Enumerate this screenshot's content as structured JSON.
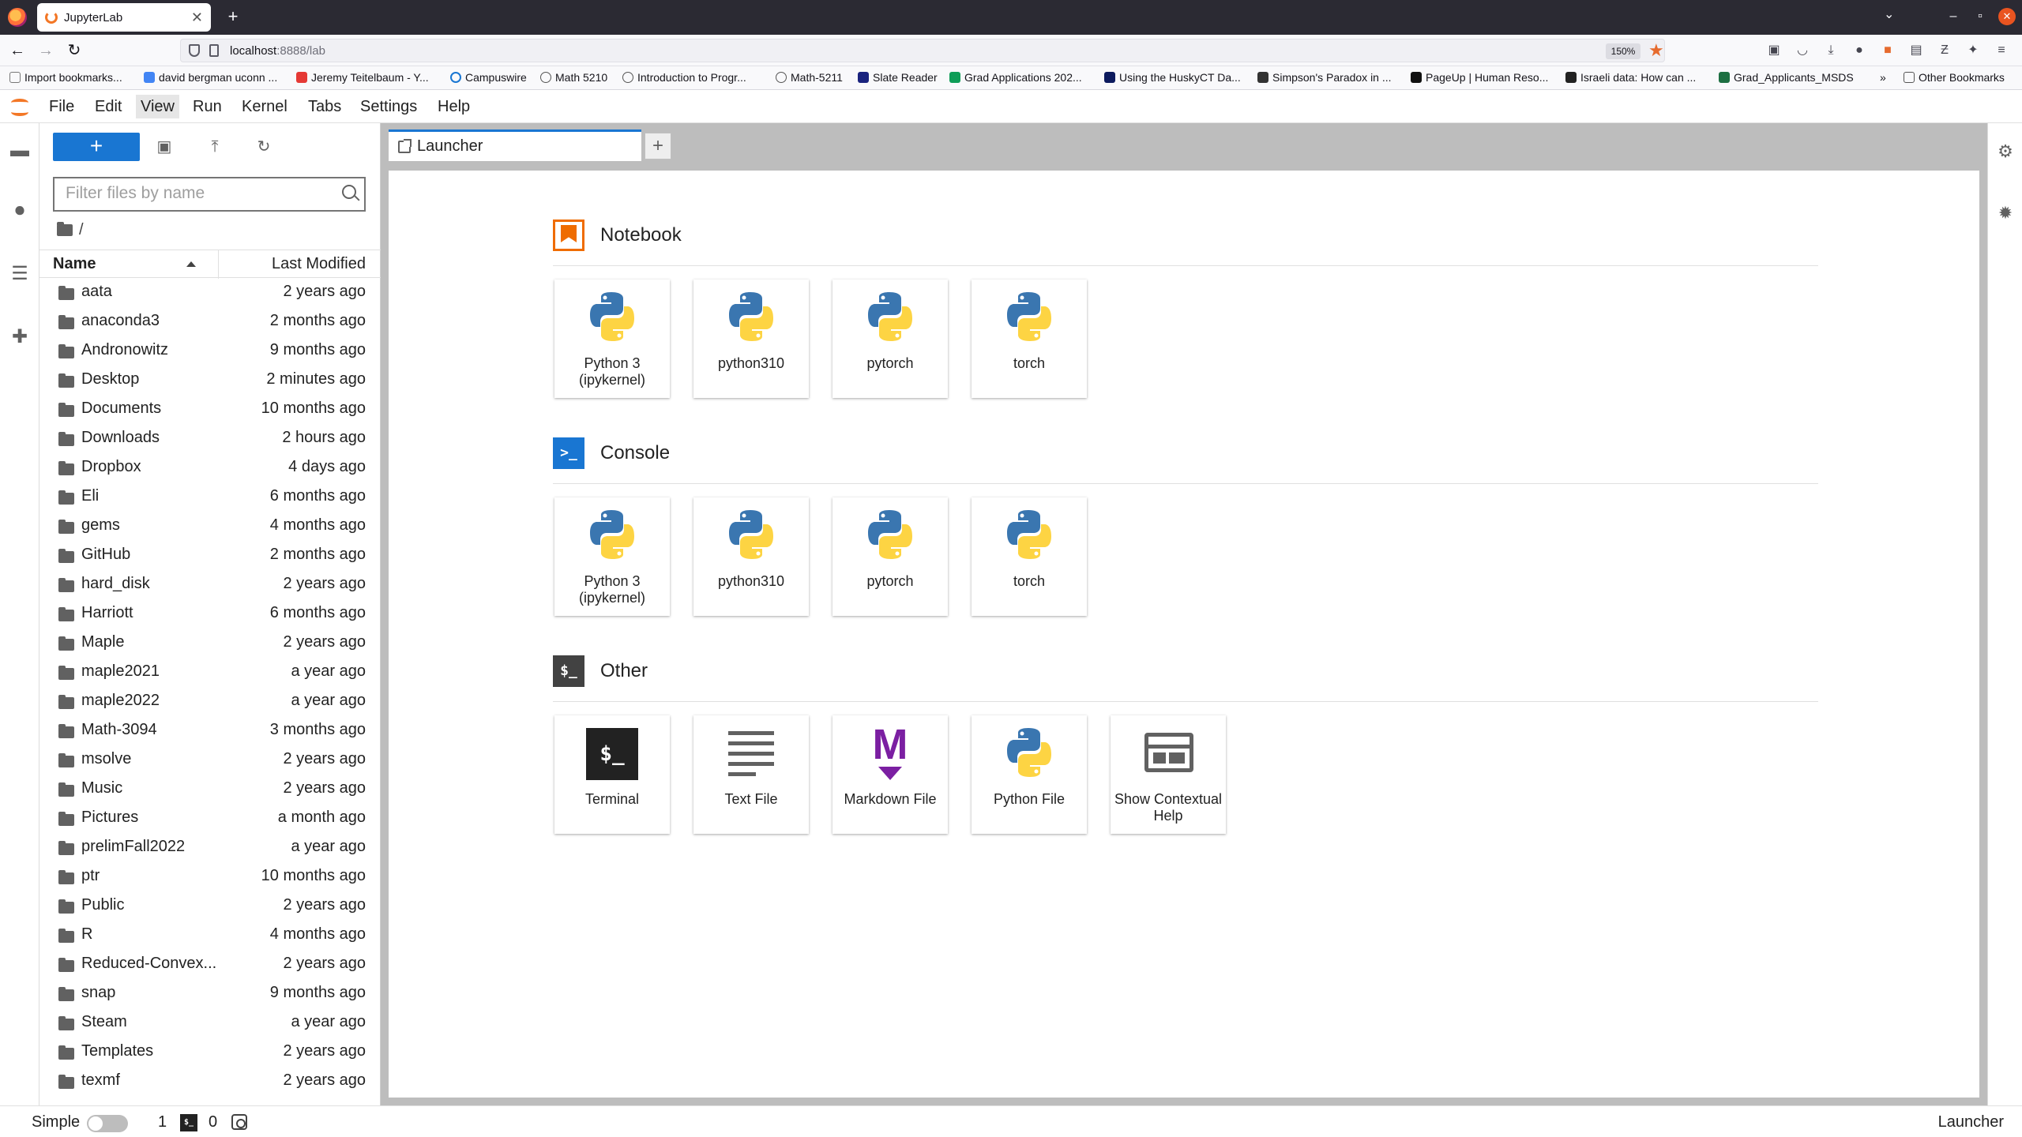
{
  "browser": {
    "tab_title": "JupyterLab",
    "url_host": "localhost",
    "url_path": ":8888/lab",
    "zoom": "150%",
    "bookmarks": [
      "Import bookmarks...",
      "david bergman uconn ...",
      "Jeremy Teitelbaum - Y...",
      "Campuswire",
      "Math 5210",
      "Introduction to Progr...",
      "Math-5211",
      "Slate Reader",
      "Grad Applications 202...",
      "Using the HuskyCT Da...",
      "Simpson's Paradox in ...",
      "PageUp | Human Reso...",
      "Israeli data: How can ...",
      "Grad_Applicants_MSDS"
    ],
    "other_bookmarks": "Other Bookmarks"
  },
  "menu": [
    "File",
    "Edit",
    "View",
    "Run",
    "Kernel",
    "Tabs",
    "Settings",
    "Help"
  ],
  "filebrowser": {
    "filter_placeholder": "Filter files by name",
    "breadcrumb": "/",
    "col_name": "Name",
    "col_modified": "Last Modified",
    "rows": [
      {
        "name": "aata",
        "modified": "2 years ago"
      },
      {
        "name": "anaconda3",
        "modified": "2 months ago"
      },
      {
        "name": "Andronowitz",
        "modified": "9 months ago"
      },
      {
        "name": "Desktop",
        "modified": "2 minutes ago"
      },
      {
        "name": "Documents",
        "modified": "10 months ago"
      },
      {
        "name": "Downloads",
        "modified": "2 hours ago"
      },
      {
        "name": "Dropbox",
        "modified": "4 days ago"
      },
      {
        "name": "Eli",
        "modified": "6 months ago"
      },
      {
        "name": "gems",
        "modified": "4 months ago"
      },
      {
        "name": "GitHub",
        "modified": "2 months ago"
      },
      {
        "name": "hard_disk",
        "modified": "2 years ago"
      },
      {
        "name": "Harriott",
        "modified": "6 months ago"
      },
      {
        "name": "Maple",
        "modified": "2 years ago"
      },
      {
        "name": "maple2021",
        "modified": "a year ago"
      },
      {
        "name": "maple2022",
        "modified": "a year ago"
      },
      {
        "name": "Math-3094",
        "modified": "3 months ago"
      },
      {
        "name": "msolve",
        "modified": "2 years ago"
      },
      {
        "name": "Music",
        "modified": "2 years ago"
      },
      {
        "name": "Pictures",
        "modified": "a month ago"
      },
      {
        "name": "prelimFall2022",
        "modified": "a year ago"
      },
      {
        "name": "ptr",
        "modified": "10 months ago"
      },
      {
        "name": "Public",
        "modified": "2 years ago"
      },
      {
        "name": "R",
        "modified": "4 months ago"
      },
      {
        "name": "Reduced-Convex...",
        "modified": "2 years ago"
      },
      {
        "name": "snap",
        "modified": "9 months ago"
      },
      {
        "name": "Steam",
        "modified": "a year ago"
      },
      {
        "name": "Templates",
        "modified": "2 years ago"
      },
      {
        "name": "texmf",
        "modified": "2 years ago"
      }
    ]
  },
  "launcher": {
    "tab_label": "Launcher",
    "notebook": {
      "title": "Notebook",
      "kernels": [
        "Python 3\n(ipykernel)",
        "python310",
        "pytorch",
        "torch"
      ]
    },
    "console": {
      "title": "Console",
      "kernels": [
        "Python 3\n(ipykernel)",
        "python310",
        "pytorch",
        "torch"
      ]
    },
    "other": {
      "title": "Other",
      "items": [
        "Terminal",
        "Text File",
        "Markdown File",
        "Python File",
        "Show Contextual\nHelp"
      ]
    }
  },
  "statusbar": {
    "simple_label": "Simple",
    "terminals_count": "1",
    "kernels_count": "0",
    "right_label": "Launcher"
  },
  "colors": {
    "accent": "#1976d2",
    "notebook": "#ef6c00",
    "markdown": "#7b1fa2"
  }
}
